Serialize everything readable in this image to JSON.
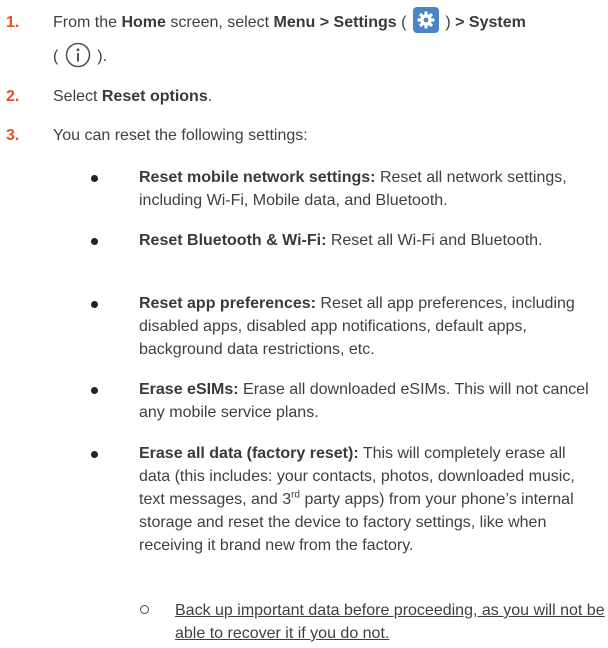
{
  "steps": [
    {
      "number": "1.",
      "parts": {
        "from": "From the ",
        "home": "Home",
        "screen": " screen, select ",
        "menu_settings": "Menu > Settings",
        "open1": " (",
        "close1": ") ",
        "system": "> System",
        "open2": "(",
        "close2": ")."
      }
    },
    {
      "number": "2.",
      "prefix": "Select ",
      "bold": "Reset options",
      "suffix": "."
    },
    {
      "number": "3.",
      "text": "You can reset the following settings:"
    }
  ],
  "icons": {
    "settings": "settings-gear-icon",
    "system": "info-icon",
    "accent": "#4a86c6",
    "number_color": "#e8501e"
  },
  "options": [
    {
      "title": "Reset mobile network settings:",
      "desc": " Reset all network settings, including Wi-Fi, Mobile data, and Bluetooth."
    },
    {
      "title": "Reset Bluetooth & Wi-Fi:",
      "desc": " Reset all Wi-Fi and Bluetooth."
    },
    {
      "title": "Reset app preferences:",
      "desc": " Reset all app preferences, including disabled apps, disabled app notifications, default apps, background data restrictions, etc."
    },
    {
      "title": "Erase eSIMs:",
      "desc": " Erase all downloaded eSIMs. This will not cancel any mobile service plans."
    },
    {
      "title": "Erase all data (factory reset):",
      "desc_a": " This will completely erase all data (this includes: your contacts, photos, downloaded music, text messages, and 3",
      "sup": "rd",
      "desc_b": " party apps) from your phone’s internal storage and reset the device to factory settings, like when receiving it brand new from the factory."
    }
  ],
  "sub_note": "Back up important data before proceeding, as you will not be able to recover it if you do not."
}
